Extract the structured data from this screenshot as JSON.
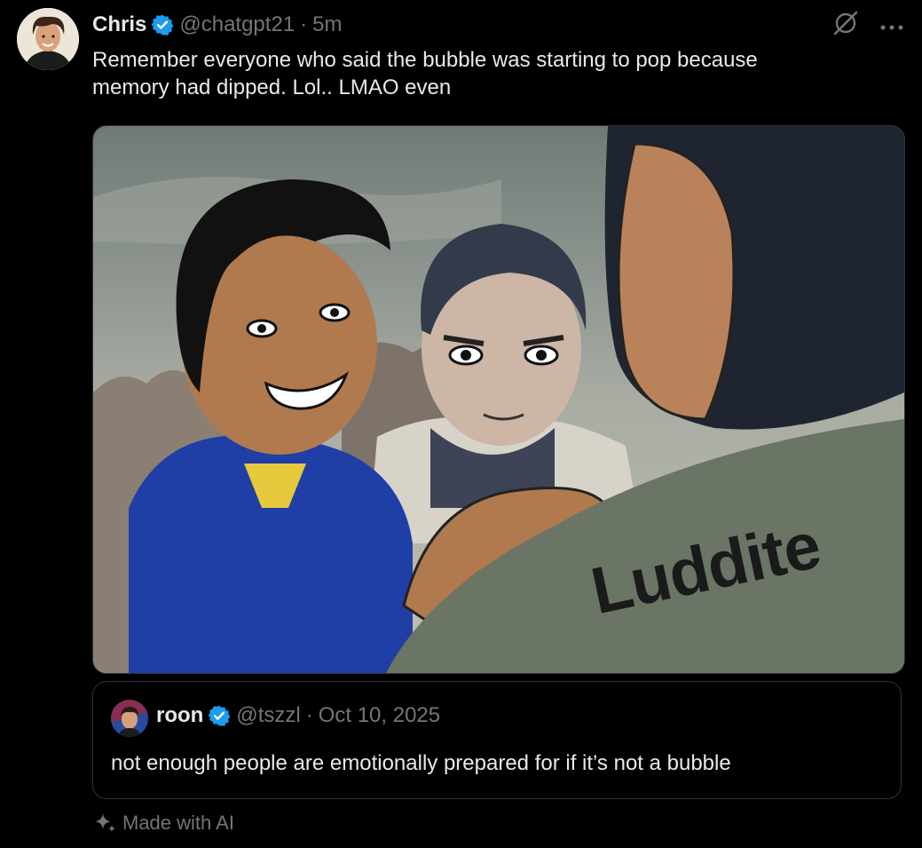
{
  "post": {
    "author_name": "Chris",
    "handle": "@chatgpt21",
    "separator": "·",
    "time": "5m",
    "text": "Remember everyone who said the bubble was starting to pop because\nmemory had dipped. Lol.. LMAO even"
  },
  "media": {
    "jacket_text": "Luddite"
  },
  "quoted_post": {
    "author_name": "roon",
    "handle": "@tszzl",
    "separator": "·",
    "date": "Oct 10, 2025",
    "text": "not enough people are emotionally prepared for if it’s not a bubble"
  },
  "footer": {
    "made_with_ai": "Made with AI"
  },
  "icons": {
    "verified": "verified-badge-icon",
    "grok": "grok-icon",
    "more": "more-icon",
    "sparkle": "sparkle-icon"
  },
  "colors": {
    "background": "#000000",
    "text": "#e7e9ea",
    "muted": "#71767b",
    "verified": "#1d9bf0",
    "border": "#2f3336"
  }
}
